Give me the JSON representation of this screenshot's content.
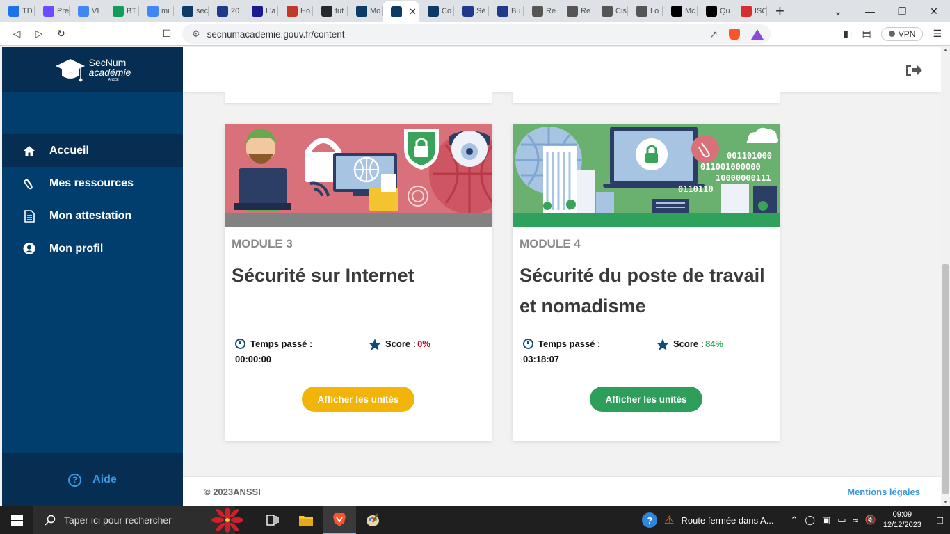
{
  "browser": {
    "tabs": [
      {
        "label": "TD",
        "icon": "google-drive-icon",
        "color": "#1a73e8"
      },
      {
        "label": "Pre",
        "icon": "proton-icon",
        "color": "#6d4aff"
      },
      {
        "label": "VI",
        "icon": "google-docs-icon",
        "color": "#4285f4"
      },
      {
        "label": "BT",
        "icon": "google-sheets-icon",
        "color": "#0f9d58"
      },
      {
        "label": "mi",
        "icon": "google-docs-icon",
        "color": "#4285f4"
      },
      {
        "label": "sec",
        "icon": "graduation-cap-icon",
        "color": "#0b3b66"
      },
      {
        "label": "20",
        "icon": "target-icon",
        "color": "#1e3a8a"
      },
      {
        "label": "L'a",
        "icon": "c-logo-icon",
        "color": "#1a1a8c"
      },
      {
        "label": "Ho",
        "icon": "k-logo-icon",
        "color": "#c0392b"
      },
      {
        "label": "tut",
        "icon": "github-icon",
        "color": "#24292e"
      },
      {
        "label": "Mo",
        "icon": "graduation-cap-icon",
        "color": "#0b3b66"
      },
      {
        "label": "",
        "icon": "graduation-cap-icon",
        "color": "#0b3b66",
        "active": true
      },
      {
        "label": "Co",
        "icon": "graduation-cap-icon",
        "color": "#0b3b66"
      },
      {
        "label": "Sé",
        "icon": "target-icon",
        "color": "#1e3a8a"
      },
      {
        "label": "Bu",
        "icon": "target-icon",
        "color": "#1e3a8a"
      },
      {
        "label": "Re",
        "icon": "globe-icon",
        "color": "#555555"
      },
      {
        "label": "Re",
        "icon": "globe-icon",
        "color": "#555555"
      },
      {
        "label": "Cis",
        "icon": "cisco-icon",
        "color": "#555555"
      },
      {
        "label": "Lo",
        "icon": "cisco-icon",
        "color": "#555555"
      },
      {
        "label": "Mc",
        "icon": "wikipedia-icon",
        "color": "#000000"
      },
      {
        "label": "Qu",
        "icon": "p-logo-icon",
        "color": "#000000"
      },
      {
        "label": "ISC",
        "icon": "iso-icon",
        "color": "#d32f2f"
      }
    ],
    "url": "secnumacademie.gouv.fr/content",
    "vpn_label": "VPN"
  },
  "logo": {
    "line1": "SecNum",
    "line2": "académie",
    "line3": "ANSSI"
  },
  "sidebar": {
    "items": [
      {
        "label": "Accueil",
        "icon": "home-icon",
        "active": true
      },
      {
        "label": "Mes ressources",
        "icon": "paperclip-icon",
        "active": false
      },
      {
        "label": "Mon attestation",
        "icon": "document-icon",
        "active": false
      },
      {
        "label": "Mon profil",
        "icon": "user-circle-icon",
        "active": false
      }
    ],
    "help_label": "Aide"
  },
  "modules": [
    {
      "module_label": "MODULE 3",
      "title": "Sécurité sur Internet",
      "time_label": "Temps passé :",
      "time_value": "00:00:00",
      "score_label": "Score :",
      "score_value": "0%",
      "score_color": "#d0021b",
      "button_label": "Afficher les unités",
      "button_color": "#f2b409",
      "bar_color": "#828282",
      "banner_color": "#d9717a",
      "progress": 0
    },
    {
      "module_label": "MODULE 4",
      "title": "Sécurité du poste de travail et nomadisme",
      "time_label": "Temps passé :",
      "time_value": "03:18:07",
      "score_label": "Score :",
      "score_value": "84%",
      "score_color": "#33a85a",
      "button_label": "Afficher les unités",
      "button_color": "#2e9e5b",
      "bar_color": "#2ea15d",
      "banner_color": "#6ab06e",
      "progress": 1
    }
  ],
  "binary_text": [
    "001101000",
    "011001000000",
    "10000000111",
    "0110110"
  ],
  "footer": {
    "copyright": "© 2023ANSSI",
    "legal": "Mentions légales"
  },
  "taskbar": {
    "search_placeholder": "Taper ici pour rechercher",
    "notification": "Route fermée dans A...",
    "time": "09:09",
    "date": "12/12/2023"
  }
}
